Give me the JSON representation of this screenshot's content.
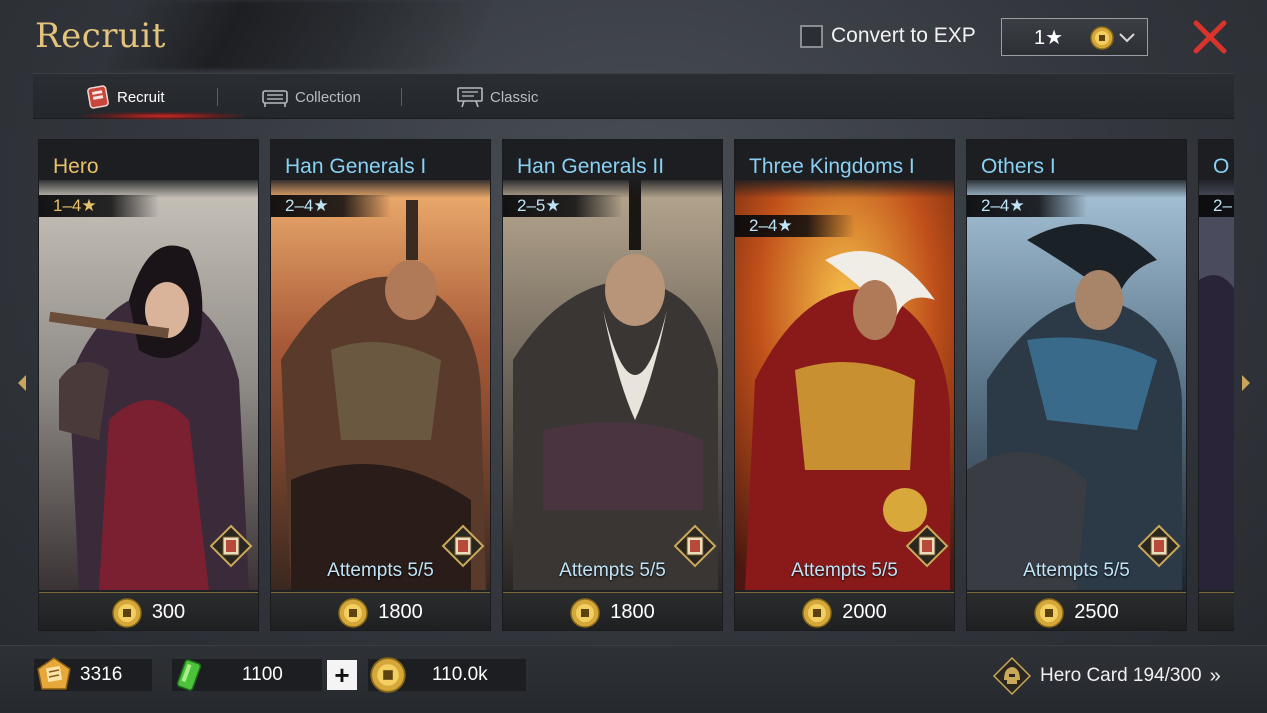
{
  "header": {
    "title": "Recruit",
    "convert_label": "Convert to EXP",
    "star_select_value": "1★"
  },
  "tabs": [
    {
      "label": "Recruit",
      "active": true
    },
    {
      "label": "Collection",
      "active": false
    },
    {
      "label": "Classic",
      "active": false
    }
  ],
  "cards": [
    {
      "name": "Hero",
      "stars": "1–4★",
      "attempts": "",
      "cost": "300",
      "theme": "gold"
    },
    {
      "name": "Han Generals I",
      "stars": "2–4★",
      "attempts": "Attempts 5/5",
      "cost": "1800",
      "theme": "blue"
    },
    {
      "name": "Han Generals II",
      "stars": "2–5★",
      "attempts": "Attempts 5/5",
      "cost": "1800",
      "theme": "blue"
    },
    {
      "name": "Three Kingdoms I",
      "stars": "2–4★",
      "attempts": "Attempts 5/5",
      "cost": "2000",
      "theme": "blue"
    },
    {
      "name": "Others I",
      "stars": "2–4★",
      "attempts": "Attempts 5/5",
      "cost": "2500",
      "theme": "blue"
    },
    {
      "name": "O",
      "stars": "2–",
      "attempts": "",
      "cost": "",
      "theme": "blue"
    }
  ],
  "resources": {
    "tickets": "3316",
    "stamina": "1100",
    "coins": "110.0k"
  },
  "hero_card": {
    "label": "Hero Card 194/300",
    "chevron": "»"
  },
  "colors": {
    "title_gold": "#e4c47d",
    "card_name_blue": "#8ad0f2",
    "close_red": "#d8342c"
  }
}
